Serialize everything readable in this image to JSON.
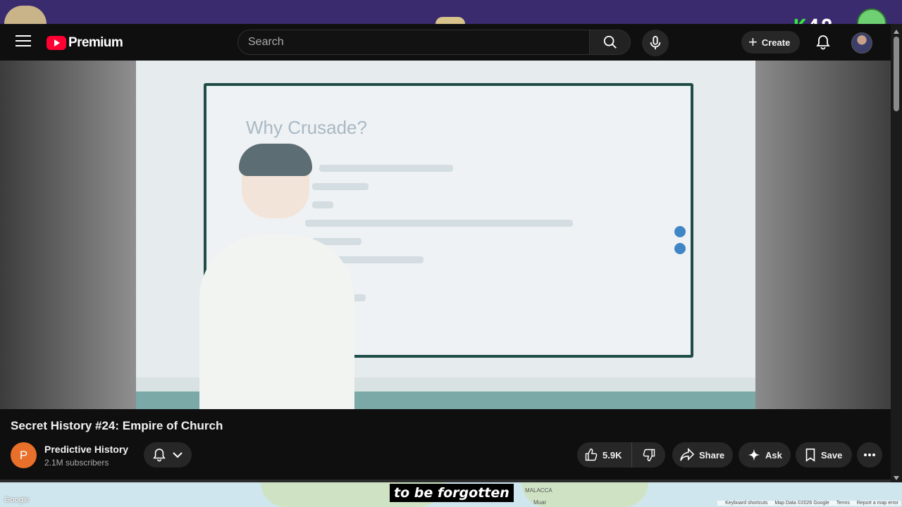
{
  "header": {
    "logo_text": "Premium",
    "search_placeholder": "Search",
    "create_label": "Create"
  },
  "overlay": {
    "k_letter": "K",
    "counter": "48"
  },
  "video": {
    "slide_title": "Why Crusade?",
    "title": "Secret History #24: Empire of Church",
    "caption": "to be forgotten"
  },
  "channel": {
    "avatar_letter": "P",
    "name": "Predictive History",
    "subscribers": "2.1M subscribers"
  },
  "actions": {
    "likes": "5.9K",
    "share": "Share",
    "ask": "Ask",
    "save": "Save"
  },
  "map": {
    "google": "Google",
    "place1": "MALACCA",
    "place2": "Muar",
    "footer": [
      "Keyboard shortcuts",
      "Map Data ©2026 Google",
      "Terms",
      "Report a map error"
    ]
  },
  "colors": {
    "brand_red": "#ff0033",
    "overlay_purple": "#3a2a6e",
    "counter_green": "#35e83b",
    "channel_orange": "#e8702a"
  },
  "icons": [
    "menu-icon",
    "youtube-logo-icon",
    "search-icon",
    "mic-icon",
    "plus-icon",
    "bell-icon",
    "chevron-down-icon",
    "thumbs-up-icon",
    "thumbs-down-icon",
    "share-icon",
    "sparkle-icon",
    "bookmark-icon",
    "more-horizontal-icon"
  ]
}
